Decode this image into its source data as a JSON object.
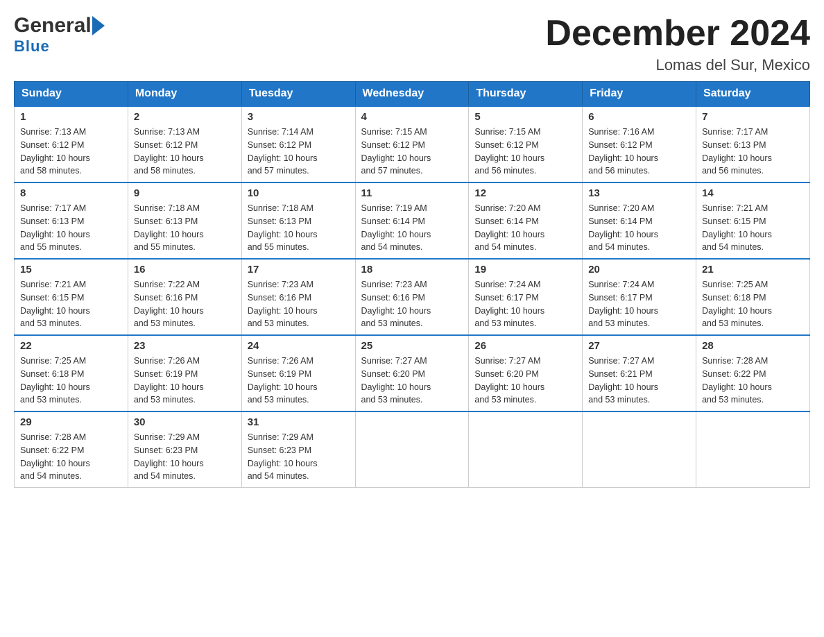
{
  "logo": {
    "general": "General",
    "blue": "Blue",
    "arrow_shape": "triangle-right"
  },
  "header": {
    "month_title": "December 2024",
    "location": "Lomas del Sur, Mexico"
  },
  "weekdays": [
    "Sunday",
    "Monday",
    "Tuesday",
    "Wednesday",
    "Thursday",
    "Friday",
    "Saturday"
  ],
  "weeks": [
    [
      {
        "day": "1",
        "sunrise": "7:13 AM",
        "sunset": "6:12 PM",
        "daylight": "10 hours and 58 minutes."
      },
      {
        "day": "2",
        "sunrise": "7:13 AM",
        "sunset": "6:12 PM",
        "daylight": "10 hours and 58 minutes."
      },
      {
        "day": "3",
        "sunrise": "7:14 AM",
        "sunset": "6:12 PM",
        "daylight": "10 hours and 57 minutes."
      },
      {
        "day": "4",
        "sunrise": "7:15 AM",
        "sunset": "6:12 PM",
        "daylight": "10 hours and 57 minutes."
      },
      {
        "day": "5",
        "sunrise": "7:15 AM",
        "sunset": "6:12 PM",
        "daylight": "10 hours and 56 minutes."
      },
      {
        "day": "6",
        "sunrise": "7:16 AM",
        "sunset": "6:12 PM",
        "daylight": "10 hours and 56 minutes."
      },
      {
        "day": "7",
        "sunrise": "7:17 AM",
        "sunset": "6:13 PM",
        "daylight": "10 hours and 56 minutes."
      }
    ],
    [
      {
        "day": "8",
        "sunrise": "7:17 AM",
        "sunset": "6:13 PM",
        "daylight": "10 hours and 55 minutes."
      },
      {
        "day": "9",
        "sunrise": "7:18 AM",
        "sunset": "6:13 PM",
        "daylight": "10 hours and 55 minutes."
      },
      {
        "day": "10",
        "sunrise": "7:18 AM",
        "sunset": "6:13 PM",
        "daylight": "10 hours and 55 minutes."
      },
      {
        "day": "11",
        "sunrise": "7:19 AM",
        "sunset": "6:14 PM",
        "daylight": "10 hours and 54 minutes."
      },
      {
        "day": "12",
        "sunrise": "7:20 AM",
        "sunset": "6:14 PM",
        "daylight": "10 hours and 54 minutes."
      },
      {
        "day": "13",
        "sunrise": "7:20 AM",
        "sunset": "6:14 PM",
        "daylight": "10 hours and 54 minutes."
      },
      {
        "day": "14",
        "sunrise": "7:21 AM",
        "sunset": "6:15 PM",
        "daylight": "10 hours and 54 minutes."
      }
    ],
    [
      {
        "day": "15",
        "sunrise": "7:21 AM",
        "sunset": "6:15 PM",
        "daylight": "10 hours and 53 minutes."
      },
      {
        "day": "16",
        "sunrise": "7:22 AM",
        "sunset": "6:16 PM",
        "daylight": "10 hours and 53 minutes."
      },
      {
        "day": "17",
        "sunrise": "7:23 AM",
        "sunset": "6:16 PM",
        "daylight": "10 hours and 53 minutes."
      },
      {
        "day": "18",
        "sunrise": "7:23 AM",
        "sunset": "6:16 PM",
        "daylight": "10 hours and 53 minutes."
      },
      {
        "day": "19",
        "sunrise": "7:24 AM",
        "sunset": "6:17 PM",
        "daylight": "10 hours and 53 minutes."
      },
      {
        "day": "20",
        "sunrise": "7:24 AM",
        "sunset": "6:17 PM",
        "daylight": "10 hours and 53 minutes."
      },
      {
        "day": "21",
        "sunrise": "7:25 AM",
        "sunset": "6:18 PM",
        "daylight": "10 hours and 53 minutes."
      }
    ],
    [
      {
        "day": "22",
        "sunrise": "7:25 AM",
        "sunset": "6:18 PM",
        "daylight": "10 hours and 53 minutes."
      },
      {
        "day": "23",
        "sunrise": "7:26 AM",
        "sunset": "6:19 PM",
        "daylight": "10 hours and 53 minutes."
      },
      {
        "day": "24",
        "sunrise": "7:26 AM",
        "sunset": "6:19 PM",
        "daylight": "10 hours and 53 minutes."
      },
      {
        "day": "25",
        "sunrise": "7:27 AM",
        "sunset": "6:20 PM",
        "daylight": "10 hours and 53 minutes."
      },
      {
        "day": "26",
        "sunrise": "7:27 AM",
        "sunset": "6:20 PM",
        "daylight": "10 hours and 53 minutes."
      },
      {
        "day": "27",
        "sunrise": "7:27 AM",
        "sunset": "6:21 PM",
        "daylight": "10 hours and 53 minutes."
      },
      {
        "day": "28",
        "sunrise": "7:28 AM",
        "sunset": "6:22 PM",
        "daylight": "10 hours and 53 minutes."
      }
    ],
    [
      {
        "day": "29",
        "sunrise": "7:28 AM",
        "sunset": "6:22 PM",
        "daylight": "10 hours and 54 minutes."
      },
      {
        "day": "30",
        "sunrise": "7:29 AM",
        "sunset": "6:23 PM",
        "daylight": "10 hours and 54 minutes."
      },
      {
        "day": "31",
        "sunrise": "7:29 AM",
        "sunset": "6:23 PM",
        "daylight": "10 hours and 54 minutes."
      },
      null,
      null,
      null,
      null
    ]
  ],
  "labels": {
    "sunrise": "Sunrise:",
    "sunset": "Sunset:",
    "daylight": "Daylight:"
  }
}
